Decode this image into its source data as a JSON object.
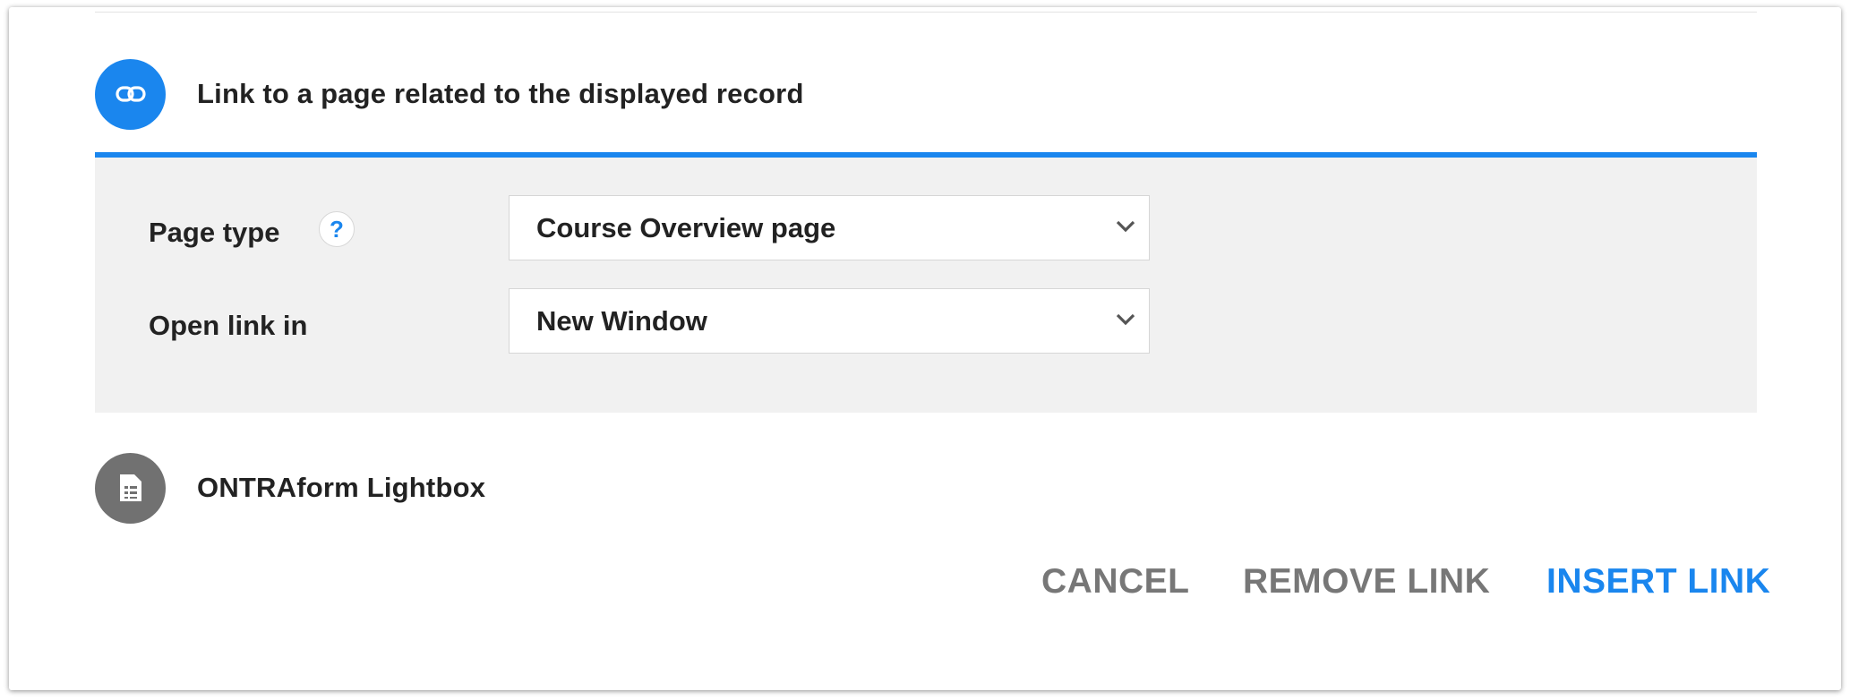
{
  "options": {
    "related_record": {
      "title": "Link to a page related to the displayed record",
      "icon": "link-icon",
      "color": "#1a86ee"
    },
    "ontraform": {
      "title": "ONTRAform Lightbox",
      "icon": "form-document-icon",
      "color": "#717171"
    }
  },
  "panel": {
    "accent_color": "#1a86ee",
    "page_type": {
      "label": "Page type",
      "help": "?",
      "value": "Course Overview page"
    },
    "open_link_in": {
      "label": "Open link in",
      "value": "New Window"
    }
  },
  "actions": {
    "cancel": "CANCEL",
    "remove_link": "REMOVE LINK",
    "insert_link": "INSERT LINK"
  }
}
